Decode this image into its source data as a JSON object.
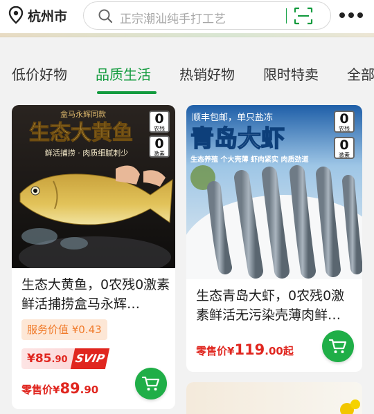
{
  "header": {
    "location_icon": "location-pin-icon",
    "city": "杭州市",
    "search_icon": "search-icon",
    "search_placeholder": "正宗潮汕纯手打工艺",
    "scan_icon": "scan-icon",
    "more_icon": "more-dots-icon"
  },
  "tabs": [
    {
      "label": "低价好物",
      "active": false
    },
    {
      "label": "品质生活",
      "active": true
    },
    {
      "label": "热销好物",
      "active": false
    },
    {
      "label": "限时特卖",
      "active": false
    },
    {
      "label": "全部",
      "active": false
    }
  ],
  "products": [
    {
      "image_title": "生态大黄鱼",
      "image_top_text": "盒马永辉同款",
      "image_sub_text": "鲜活捕捞 · 肉质细腻刺少",
      "badges": [
        {
          "num": "0",
          "cap": "农残"
        },
        {
          "num": "0",
          "cap": "激素"
        }
      ],
      "title": "生态大黄鱼，0农残0激素鲜活捕捞盒马永辉…",
      "service_label": "服务价值 ¥0.43",
      "svip_price_yuan": "¥85",
      "svip_price_fen": ".90",
      "svip_badge": "SVIP",
      "retail_label": "零售价¥",
      "retail_yuan": "89",
      "retail_fen": ".90",
      "cart_icon": "cart-icon"
    },
    {
      "image_title": "青岛大虾",
      "image_top_text": "顺丰包邮，单只盐冻",
      "image_tags": "生态养殖  个大壳薄  虾肉紧实  肉质劲道",
      "badges": [
        {
          "num": "0",
          "cap": "农残"
        },
        {
          "num": "0",
          "cap": "激素"
        }
      ],
      "title": "生态青岛大虾，0农残0激素鲜活无污染壳薄肉鲜…",
      "retail_label": "零售价¥",
      "retail_yuan": "119",
      "retail_fen": ".00起",
      "cart_icon": "cart-icon"
    }
  ],
  "colors": {
    "brand_green": "#139b3e",
    "price_red": "#e0261f",
    "service_orange": "#f07a2a"
  }
}
